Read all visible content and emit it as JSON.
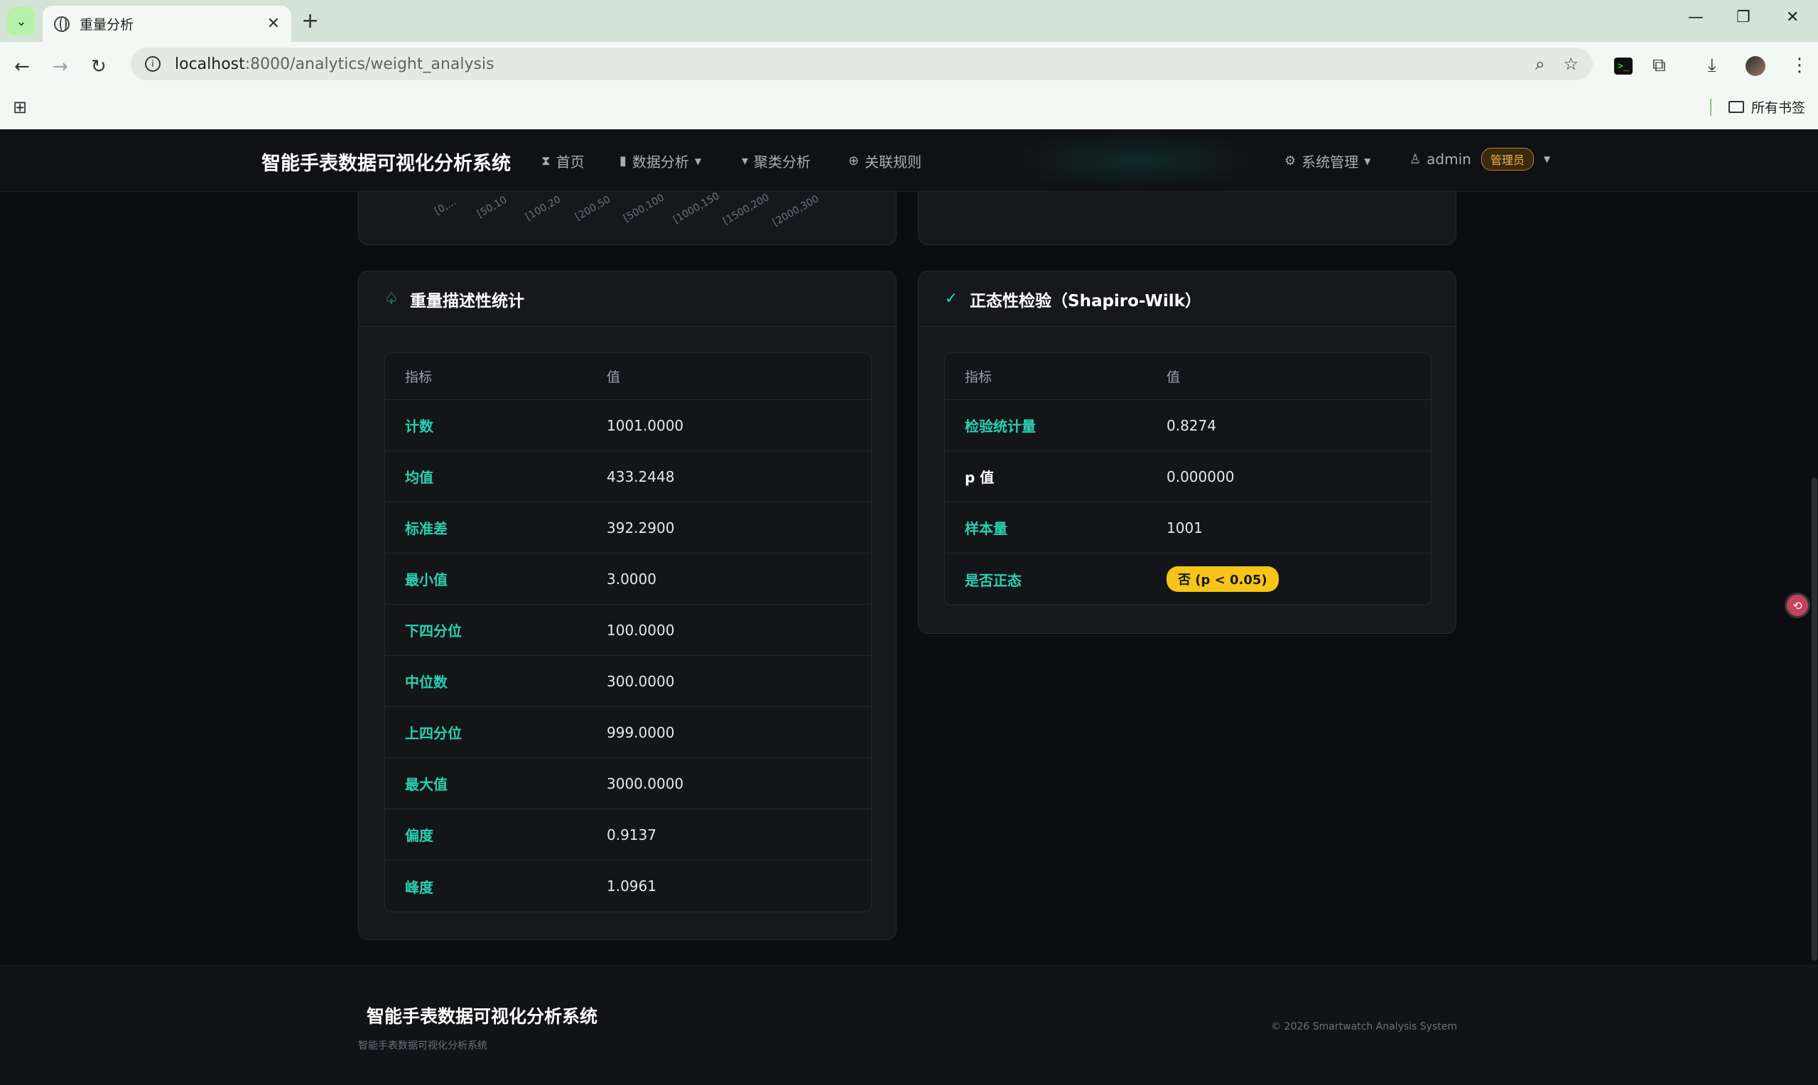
{
  "browser": {
    "tab_title": "重量分析",
    "url_host": "localhost",
    "url_rest": ":8000/analytics/weight_analysis",
    "bookmarks_label": "所有书签"
  },
  "navbar": {
    "brand": "智能手表数据可视化分析系统",
    "items": [
      {
        "label": "首页",
        "icon": "hourglass-icon"
      },
      {
        "label": "数据分析",
        "icon": "bar-chart-icon",
        "dropdown": true
      },
      {
        "label": "聚类分析",
        "icon": "thumb-down-icon"
      },
      {
        "label": "关联规则",
        "icon": "gamepad-icon"
      }
    ],
    "system_menu": "系统管理",
    "user_name": "admin",
    "user_role": "管理员"
  },
  "chart_ticks": [
    "[0,...",
    "[50,10",
    "[100,20",
    "[200,50",
    "[500,100",
    "[1000,150",
    "[1500,200",
    "[2000,300"
  ],
  "descriptive": {
    "title": "重量描述性统计",
    "col_metric": "指标",
    "col_value": "值",
    "rows": [
      {
        "k": "计数",
        "v": "1001.0000"
      },
      {
        "k": "均值",
        "v": "433.2448"
      },
      {
        "k": "标准差",
        "v": "392.2900"
      },
      {
        "k": "最小值",
        "v": "3.0000"
      },
      {
        "k": "下四分位",
        "v": "100.0000"
      },
      {
        "k": "中位数",
        "v": "300.0000"
      },
      {
        "k": "上四分位",
        "v": "999.0000"
      },
      {
        "k": "最大值",
        "v": "3000.0000"
      },
      {
        "k": "偏度",
        "v": "0.9137"
      },
      {
        "k": "峰度",
        "v": "1.0961"
      }
    ]
  },
  "normality": {
    "title": "正态性检验（Shapiro-Wilk）",
    "col_metric": "指标",
    "col_value": "值",
    "rows": [
      {
        "k": "检验统计量",
        "v": "0.8274"
      },
      {
        "k": "p 值",
        "v": "0.000000"
      },
      {
        "k": "样本量",
        "v": "1001"
      },
      {
        "k": "是否正态",
        "v": "否 (p < 0.05)"
      }
    ]
  },
  "footer": {
    "title": "智能手表数据可视化分析系统",
    "subtitle": "智能手表数据可视化分析系统",
    "copyright": "© 2026 Smartwatch Analysis System"
  },
  "colors": {
    "accent": "#2ad0b0",
    "warning": "#f5c518",
    "bg": "#0c0d10",
    "card": "#17181c"
  }
}
